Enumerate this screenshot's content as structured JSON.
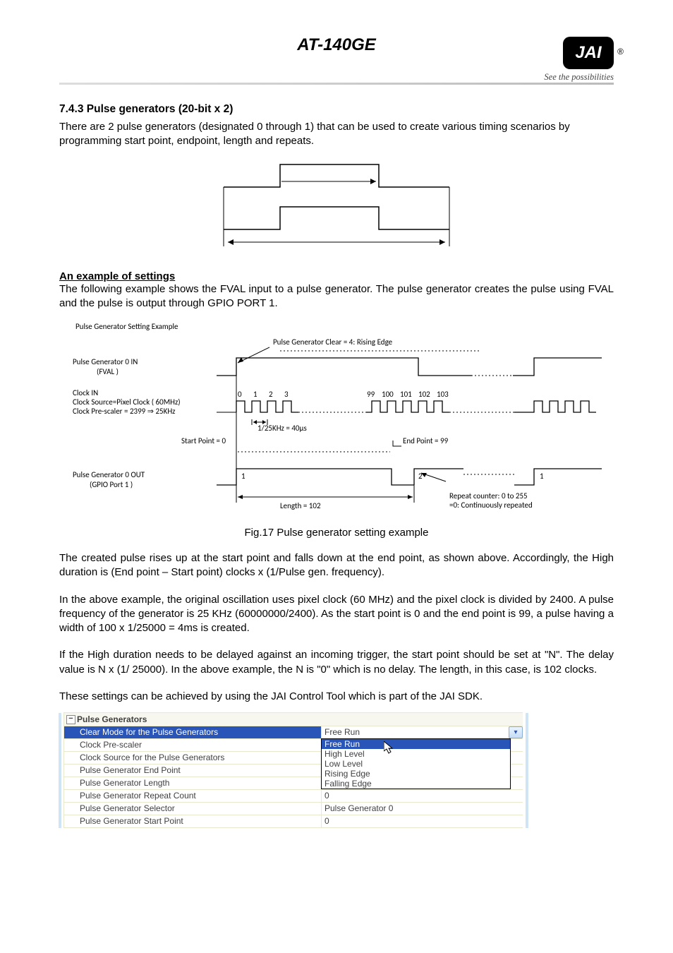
{
  "header": {
    "model": "AT-140GE",
    "logo_text": "JAI",
    "tagline": "See the possibilities"
  },
  "section": {
    "num_title": "7.4.3   Pulse generators (20-bit x 2)",
    "intro": "There are 2 pulse generators (designated 0 through 1) that can be used to create various timing scenarios by programming start point, endpoint, length and repeats.",
    "example_heading": "An example of settings",
    "example_intro": "The following example shows the FVAL input to a pulse generator. The pulse generator creates the pulse using FVAL and the pulse is output through GPIO PORT 1.",
    "diagram_title": "Pulse Generator Setting Example",
    "fig_caption": "Fig.17   Pulse generator setting example",
    "p1": "The created pulse rises up at the start point and falls down at the end point, as shown above. Accordingly, the High duration is (End point – Start point) clocks x (1/Pulse gen. frequency).",
    "p2": "In the above example, the original oscillation uses pixel clock (60 MHz) and the pixel clock is divided by 2400. A pulse frequency of the generator is 25 KHz (60000000/2400). As the start point is 0 and the end point is 99, a pulse having a width of 100 x 1/25000 = 4ms is created.",
    "p3": "If the High duration needs to be delayed against an incoming trigger, the start point should be set at \"N\". The delay value is N x (1/ 25000). In the above example, the N is \"0\" which is no delay.  The length, in this case, is 102 clocks.",
    "p4": "These settings can be achieved by using the JAI Control Tool which is part of the JAI SDK."
  },
  "timing": {
    "clear_label": "Pulse Generator Clear = 4: Rising Edge",
    "in_label_1": "Pulse Generator 0    IN",
    "in_label_2": "(FVAL  )",
    "clk_label_1": "Clock IN",
    "clk_label_2": "Clock Source=Pixel Clock ( 60MHz)",
    "clk_label_3": "Clock Pre-scaler = 2399 ⇒  25KHz",
    "ticks_left": [
      "0",
      "1",
      "2",
      "3"
    ],
    "ticks_right": [
      "99",
      "100",
      "101",
      "102",
      "103"
    ],
    "period_label": "1/25KHz = 40µs",
    "start_label": "Start Point = 0",
    "end_label": "End Point = 99",
    "out_label_1": "Pulse Generator 0    OUT",
    "out_label_2": "(GPIO Port 1  )",
    "pulse_nums": [
      "1",
      "2",
      "1"
    ],
    "length_label": "Length = 102",
    "repeat_1": "Repeat counter: 0 to 255",
    "repeat_2": "=0: Continuously repeated"
  },
  "grid": {
    "group": "Pulse Generators",
    "selected_name": "Clear Mode for the Pulse Generators",
    "selected_value": "Free Run",
    "dropdown": [
      "Free Run",
      "High Level",
      "Low Level",
      "Rising Edge",
      "Falling Edge"
    ],
    "rows": [
      {
        "name": "Clock Pre-scaler",
        "value": ""
      },
      {
        "name": "Clock Source for the Pulse Generators",
        "value": ""
      },
      {
        "name": "Pulse Generator End Point",
        "value": ""
      },
      {
        "name": "Pulse Generator Length",
        "value": ""
      },
      {
        "name": "Pulse Generator Repeat Count",
        "value": "0"
      },
      {
        "name": "Pulse Generator Selector",
        "value": "Pulse Generator 0"
      },
      {
        "name": "Pulse Generator Start Point",
        "value": "0"
      }
    ]
  }
}
